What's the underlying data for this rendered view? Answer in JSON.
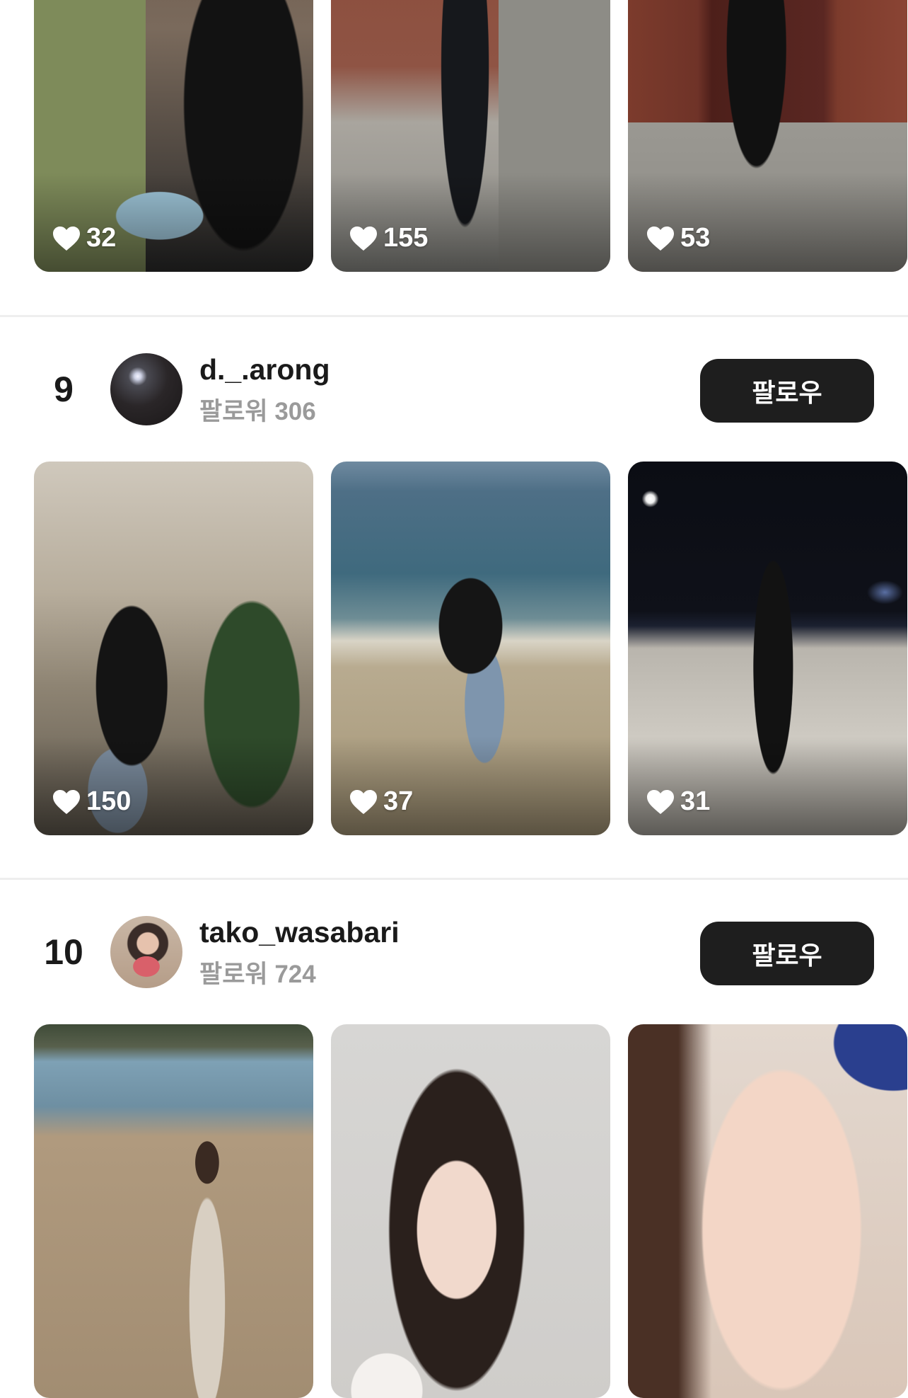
{
  "section_top": {
    "posts": [
      {
        "likes": "32",
        "scene": "puffer-coat-brick-wall"
      },
      {
        "likes": "155",
        "scene": "black-puffer-street"
      },
      {
        "likes": "53",
        "scene": "red-door-steps"
      }
    ]
  },
  "users": [
    {
      "rank": "9",
      "username": "d._.arong",
      "followers_label": "팔로워 306",
      "follow_label": "팔로우",
      "posts": [
        {
          "likes": "150",
          "scene": "christmas-tree"
        },
        {
          "likes": "37",
          "scene": "beach-day"
        },
        {
          "likes": "31",
          "scene": "beach-night"
        }
      ]
    },
    {
      "rank": "10",
      "username": "tako_wasabari",
      "followers_label": "팔로워 724",
      "follow_label": "팔로우",
      "posts": [
        {
          "likes": "",
          "scene": "beach-walk"
        },
        {
          "likes": "",
          "scene": "peace-sign-selfie"
        },
        {
          "likes": "",
          "scene": "beanie-closeup"
        }
      ]
    }
  ],
  "icons": {
    "like": "heart-icon"
  },
  "colors": {
    "follow_button": "#1e1e1e",
    "follower_text": "#9a9a9a",
    "divider": "#eeeeee"
  }
}
